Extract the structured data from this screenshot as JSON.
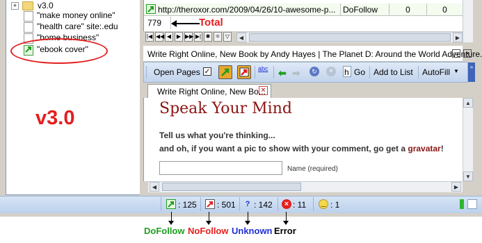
{
  "tree": {
    "items": [
      {
        "label": "v3.0",
        "kind": "folder"
      },
      {
        "label": "\"make money online\"",
        "kind": "query"
      },
      {
        "label": "\"health care\" site:.edu",
        "kind": "query"
      },
      {
        "label": "\"home business\"",
        "kind": "query"
      },
      {
        "label": "\"ebook cover\"",
        "kind": "query-new"
      }
    ],
    "version_annotation": "v3.0"
  },
  "grid": {
    "row": {
      "url": "http://theroxor.com/2009/04/26/10-awesome-p...",
      "type": "DoFollow",
      "col3": "0",
      "col4": "0"
    },
    "total_count": "779",
    "total_annotation": "Total",
    "nav_buttons": [
      "|◀",
      "◀◀",
      "◀",
      "▶",
      "▶▶",
      "▶|",
      "✱",
      "✱",
      "filter"
    ]
  },
  "window": {
    "title": "Write Right Online, New Book by Andy Hayes | The Planet D: Around the World Adventure..."
  },
  "toolbar": {
    "open_pages": "Open Pages",
    "spell_label": "abc",
    "go_label": "Go",
    "h_field": "h",
    "add_to_list": "Add to List",
    "autofill": "AutoFill"
  },
  "tab": {
    "label": "Write Right Online, New Bo..."
  },
  "webpage": {
    "heading": "Speak Your Mind",
    "line1": "Tell us what you're thinking...",
    "line2_prefix": "and oh, if you want a pic to show with your comment, go get a ",
    "line2_link": "gravatar",
    "line2_suffix": "!",
    "name_label": "Name (required)"
  },
  "status": {
    "dofollow": ": 125",
    "nofollow": ": 501",
    "unknown": ": 142",
    "error": ": 11",
    "smiley": ": 1"
  },
  "legend": {
    "dofollow": "DoFollow",
    "nofollow": "NoFollow",
    "unknown": "Unknown",
    "error": "Error"
  },
  "colors": {
    "dofollow": "#1e9e1e",
    "nofollow": "#e41e1e",
    "unknown": "#1f2ed6",
    "error": "#000000",
    "annotation_red": "#e41e1e"
  }
}
